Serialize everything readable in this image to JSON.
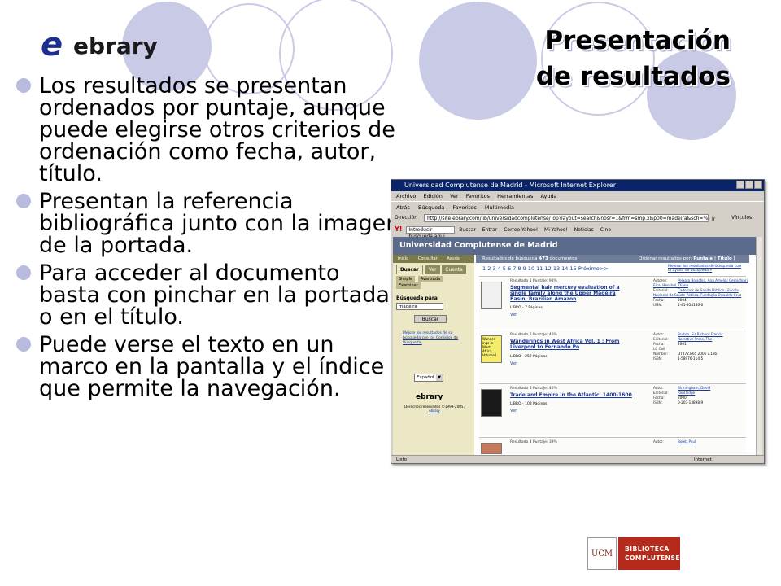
{
  "logo": {
    "mark": "e",
    "text": "ebrary"
  },
  "title": {
    "line1": "Presentación",
    "line2": "de resultados"
  },
  "bullets": [
    "Los resultados se presentan ordenados por puntaje, aunque puede elegirse otros criterios de ordenación como fecha, autor, título.",
    "Presentan la referencia bibliográfica junto con la imagen de la portada.",
    "Para acceder al documento basta con pinchar en la portada o en el título.",
    "Puede verse el texto en un marco en la pantalla y el índice que permite la navegación."
  ],
  "browser": {
    "window_title": "Universidad Complutense de Madrid - Microsoft Internet Explorer",
    "menu": [
      "Archivo",
      "Edición",
      "Ver",
      "Favoritos",
      "Herramientas",
      "Ayuda"
    ],
    "toolbar": [
      "Atrás",
      "Búsqueda",
      "Favoritos",
      "Multimedia"
    ],
    "address_label": "Dirección",
    "address_value": "http://site.ebrary.com/lib/universidadcomplutense/Top?layout=search&nosr=1&frm=smp.x&p00=madeira&sch=%A0%A0%A0",
    "go_label": "Ir",
    "links_label": "Vínculos",
    "yahoo": {
      "logo": "Y!",
      "search_placeholder": "Introducir búsqueda aquí",
      "search_button": "Buscar",
      "items": [
        "Entrar",
        "Correo Yahoo!",
        "Mi Yahoo!",
        "Noticias",
        "Cine"
      ]
    },
    "page_header": "Universidad Complutense de Madrid",
    "sidebar": {
      "top_tabs": [
        "Inicio",
        "Consultar",
        "Ayuda"
      ],
      "tabs": [
        "Buscar",
        "Ver",
        "Cuenta"
      ],
      "active_tab": "Buscar",
      "subtabs": [
        "Simple",
        "Avanzada",
        "Examinar"
      ],
      "search_label": "Búsqueda para",
      "search_value": "madeira",
      "search_button": "Buscar",
      "help_link": "Mejore los resultados de su búsqueda con los Consejos de Búsqueda.",
      "language": "Español",
      "footer_logo": "ebrary",
      "copyright": "Derechos reservados ©1999-2005,",
      "copyright_link": "ebrary"
    },
    "results_bar": {
      "prefix": "Resultados de búsqueda",
      "count": "473",
      "suffix": "documentos",
      "order_label": "Ordenar resultados por:",
      "order_options": "Puntaje | Título | Autor | Fecha"
    },
    "pagination": "1 2 3 4 5 6 7 8 9 10 11 12 13 14 15 Próximo>>",
    "improve_link": "Mejorar los resultados de búsqueda con la ayuda de búsqueda »",
    "results": [
      {
        "meta": "Resultado 1     Puntaje: 98%",
        "title": "Segmental hair mercury evaluation of a single family along the Upper Madeira Basin, Brazilian Amazon",
        "libro": "LIBRO - 7 Páginas",
        "ver": "Ver",
        "cover": "",
        "info": [
          {
            "k": "Autores:",
            "v": "Peixoto Boischio, Ana Amélia; Cernichiari, Elsa; Henshel, Diane"
          },
          {
            "k": "Editorial:",
            "v": "Cadernos de Saúde Pública - Escola Nacional de Saúde Pública, Fundação Oswaldo Cruz"
          },
          {
            "k": "Fecha:",
            "v": "2004"
          },
          {
            "k": "ISSN:",
            "v": "1-41-354146-6"
          }
        ]
      },
      {
        "meta": "Resultado 2     Puntaje: 40%",
        "title": "Wanderings in West Africa Vol. 1 : From Liverpool to Fernando Po",
        "libro": "LIBRO - 259 Páginas",
        "ver": "Ver",
        "cover": "Wander-ings in West Africa, Volume I",
        "info": [
          {
            "k": "Autor:",
            "v": "Burton, Sir Richard Francis"
          },
          {
            "k": "Editorial:",
            "v": "Narrative Press, The"
          },
          {
            "k": "Fecha:",
            "v": "2001"
          },
          {
            "k": "LC Call Number:",
            "v": "DT472.B65 2001 v.1eb"
          },
          {
            "k": "ISBN:",
            "v": "1-58976-114-5"
          }
        ]
      },
      {
        "meta": "Resultado 3     Puntaje: 40%",
        "title": "Trade and Empire in the Atlantic, 1400-1600",
        "libro": "LIBRO - 108 Páginas",
        "ver": "Ver",
        "cover": "",
        "info": [
          {
            "k": "Autor:",
            "v": "Birmingham, David"
          },
          {
            "k": "Editorial:",
            "v": "Routledge"
          },
          {
            "k": "Fecha:",
            "v": "2000"
          },
          {
            "k": "ISBN:",
            "v": "0-203-13898-9"
          }
        ]
      },
      {
        "meta": "Resultado 4     Puntaje: 39%",
        "title": "",
        "libro": "",
        "ver": "",
        "cover": "",
        "info": [
          {
            "k": "Autor:",
            "v": "Bolet, Paul"
          }
        ]
      }
    ],
    "status": "Listo",
    "zone": "Internet"
  },
  "biblioteca_logo": {
    "mark": "UCM",
    "line1": "BIBLIOTECA",
    "line2": "COMPLUTENSE"
  },
  "colors": {
    "circles": "#c9cbe6",
    "bullet": "#b9bbdd",
    "ie_title": "#0a246a",
    "brand_red": "#b52a1a"
  }
}
